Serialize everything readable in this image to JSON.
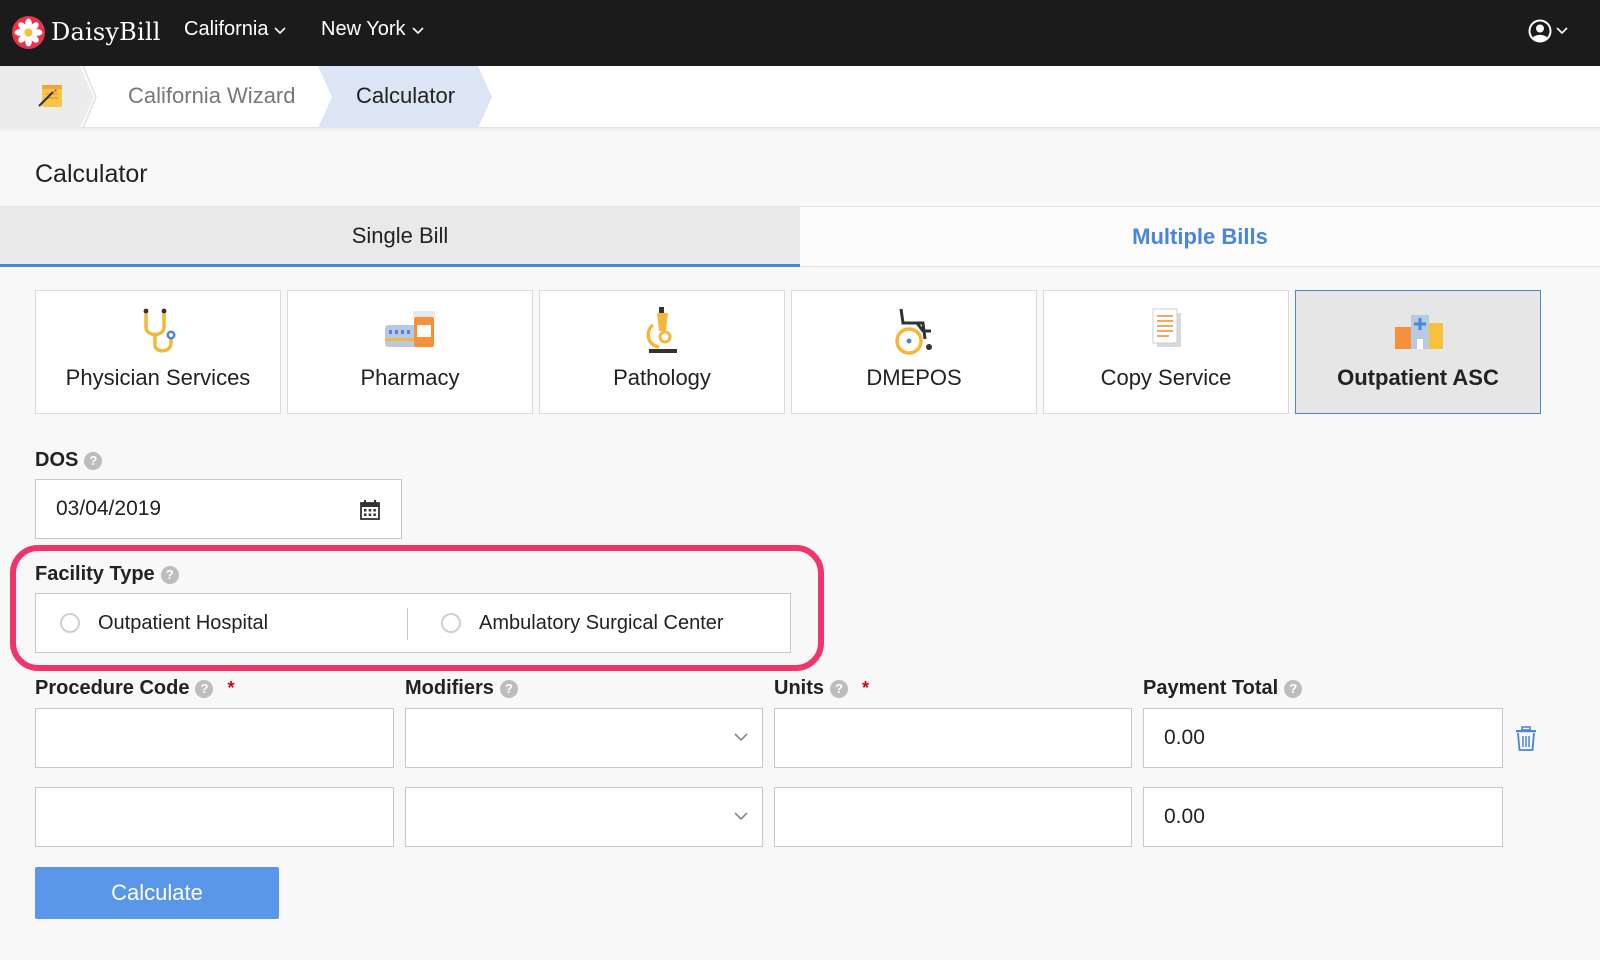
{
  "app": {
    "name": "DaisyBill"
  },
  "nav": {
    "states": [
      "California",
      "New York"
    ]
  },
  "breadcrumb": {
    "items": [
      "California Wizard",
      "Calculator"
    ]
  },
  "page": {
    "title": "Calculator"
  },
  "tabs": {
    "single": "Single Bill",
    "multiple": "Multiple Bills",
    "active": "Single Bill"
  },
  "services": [
    {
      "label": "Physician Services",
      "icon": "stethoscope-icon"
    },
    {
      "label": "Pharmacy",
      "icon": "pharmacy-icon"
    },
    {
      "label": "Pathology",
      "icon": "microscope-icon"
    },
    {
      "label": "DMEPOS",
      "icon": "wheelchair-icon"
    },
    {
      "label": "Copy Service",
      "icon": "document-icon"
    },
    {
      "label": "Outpatient ASC",
      "icon": "hospital-icon",
      "selected": true
    }
  ],
  "form": {
    "dos": {
      "label": "DOS",
      "value": "03/04/2019"
    },
    "facility": {
      "label": "Facility Type",
      "options": [
        "Outpatient Hospital",
        "Ambulatory Surgical Center"
      ],
      "selected": null
    },
    "columns": {
      "procedure": "Procedure Code",
      "modifiers": "Modifiers",
      "units": "Units",
      "payment": "Payment Total"
    },
    "rows": [
      {
        "procedure": "",
        "modifiers": "",
        "units": "",
        "payment": "0.00"
      },
      {
        "procedure": "",
        "modifiers": "",
        "units": "",
        "payment": "0.00"
      }
    ],
    "calculate_label": "Calculate"
  },
  "colors": {
    "accent": "#4a86d8",
    "button": "#5b97e8",
    "highlight": "#f0346c",
    "nav_bg": "#1b1b1b",
    "required": "#d0021b"
  }
}
